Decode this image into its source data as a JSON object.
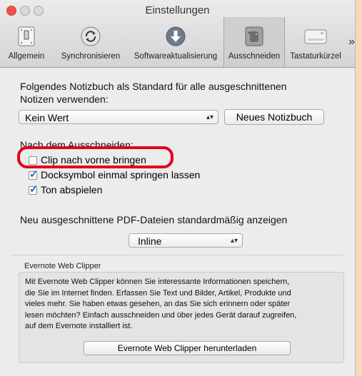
{
  "window": {
    "title": "Einstellungen"
  },
  "toolbar": {
    "items": [
      {
        "label": "Allgemein",
        "icon": "switch-icon"
      },
      {
        "label": "Synchronisieren",
        "icon": "sync-icon"
      },
      {
        "label": "Softwareaktualisierung",
        "icon": "download-icon"
      },
      {
        "label": "Ausschneiden",
        "icon": "elephant-icon",
        "selected": true
      },
      {
        "label": "Tastaturkürzel",
        "icon": "keyboard-icon"
      }
    ],
    "overflow": "»"
  },
  "main": {
    "default_notebook_label_line1": "Folgendes Notizbuch als Standard für alle ausgeschnittenen",
    "default_notebook_label_line2": "Notizen verwenden:",
    "notebook_select_value": "Kein Wert",
    "new_notebook_button": "Neues Notizbuch",
    "after_clip_label": "Nach dem Ausschneiden:",
    "checkboxes": [
      {
        "label": "Clip nach vorne bringen",
        "checked": false
      },
      {
        "label": "Docksymbol einmal springen lassen",
        "checked": true
      },
      {
        "label": "Ton abspielen",
        "checked": true
      }
    ],
    "pdf_label": "Neu ausgeschnittene PDF-Dateien standardmäßig anzeigen",
    "pdf_select_value": "Inline"
  },
  "web_clipper": {
    "group_title": "Evernote Web Clipper",
    "lines": [
      "Mit Evernote Web Clipper können Sie interessante Informationen speichern,",
      "die Sie im Internet finden. Erfassen Sie Text und Bilder, Artikel, Produkte und",
      "vieles mehr. Sie haben etwas gesehen, an das Sie sich erinnern oder später",
      "lesen möchten? Einfach ausschneiden und über jedes Gerät darauf zugreifen,",
      "auf dem Evernote installiert ist."
    ],
    "download_button": "Evernote Web Clipper herunterladen"
  },
  "colors": {
    "highlight": "#e3001b",
    "background": "#f7d9b9",
    "window": "#ececec"
  }
}
